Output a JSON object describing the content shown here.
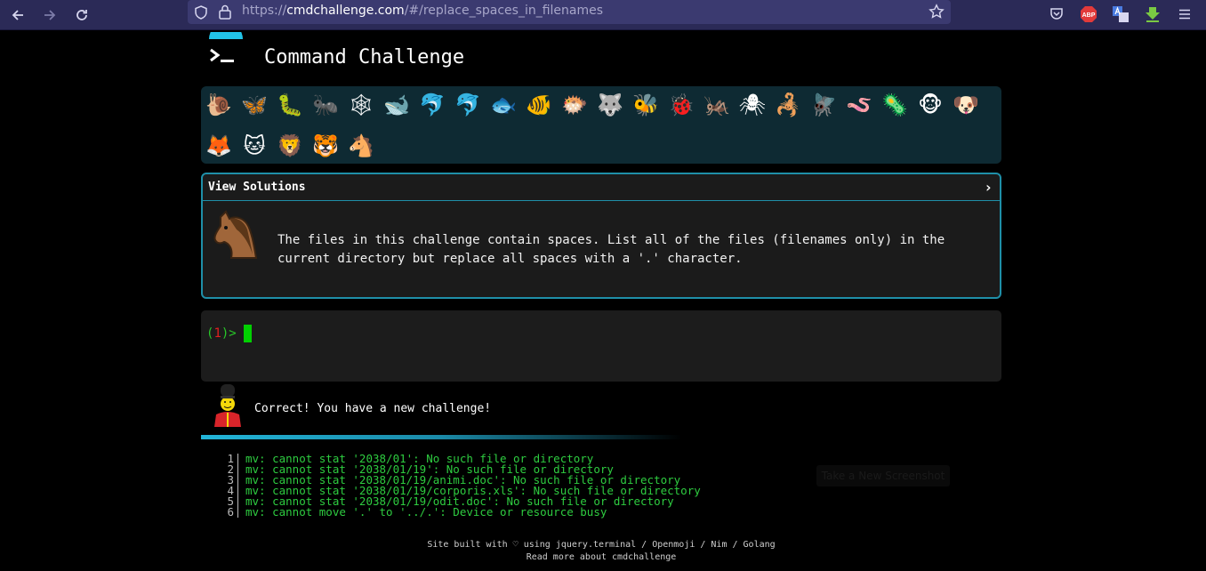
{
  "browser": {
    "url_prefix": "https://",
    "url_domain": "cmdchallenge.com",
    "url_path": "/#/replace_spaces_in_filenames",
    "ext_abp": "ABP"
  },
  "header": {
    "title": "Command Challenge"
  },
  "animals": [
    {
      "name": "snail",
      "glyph": "🐌"
    },
    {
      "name": "butterfly",
      "glyph": "🦋"
    },
    {
      "name": "caterpillar",
      "glyph": "🐛"
    },
    {
      "name": "ant",
      "glyph": "🐜"
    },
    {
      "name": "web",
      "glyph": "🕸"
    },
    {
      "name": "whale",
      "glyph": "🐋"
    },
    {
      "name": "dolphin",
      "glyph": "🐬"
    },
    {
      "name": "dolphin-grey",
      "glyph": "🐬"
    },
    {
      "name": "fish",
      "glyph": "🐟"
    },
    {
      "name": "tropical-fish",
      "glyph": "🐠"
    },
    {
      "name": "pufferfish",
      "glyph": "🐡"
    },
    {
      "name": "wolf",
      "glyph": "🐺"
    },
    {
      "name": "bee",
      "glyph": "🐝"
    },
    {
      "name": "ladybug",
      "glyph": "🐞"
    },
    {
      "name": "cricket",
      "glyph": "🦗"
    },
    {
      "name": "spider",
      "glyph": "🕷"
    },
    {
      "name": "scorpion",
      "glyph": "🦂"
    },
    {
      "name": "fly",
      "glyph": "🪰"
    },
    {
      "name": "worm",
      "glyph": "🪱"
    },
    {
      "name": "microbe",
      "glyph": "🦠"
    },
    {
      "name": "monkey",
      "glyph": "🐵"
    },
    {
      "name": "dog",
      "glyph": "🐶"
    },
    {
      "name": "fox",
      "glyph": "🦊"
    },
    {
      "name": "cat",
      "glyph": "🐱"
    },
    {
      "name": "lion",
      "glyph": "🦁"
    },
    {
      "name": "tiger",
      "glyph": "🐯"
    },
    {
      "name": "horse",
      "glyph": "🐴"
    }
  ],
  "challenge": {
    "view_solutions": "View Solutions",
    "chevron": "›",
    "description": "The files in this challenge contain spaces. List all of the files (filenames only) in the current directory but replace all spaces with a '.' character."
  },
  "terminal": {
    "prompt_open": "(",
    "prompt_num": "1",
    "prompt_close": ")>"
  },
  "status": {
    "message": "Correct! You have a new challenge!"
  },
  "output": [
    {
      "n": "1",
      "text": "mv: cannot stat '2038/01': No such file or directory"
    },
    {
      "n": "2",
      "text": "mv: cannot stat '2038/01/19': No such file or directory"
    },
    {
      "n": "3",
      "text": "mv: cannot stat '2038/01/19/animi.doc': No such file or directory"
    },
    {
      "n": "4",
      "text": "mv: cannot stat '2038/01/19/corporis.xls': No such file or directory"
    },
    {
      "n": "5",
      "text": "mv: cannot stat '2038/01/19/odit.doc': No such file or directory"
    },
    {
      "n": "6",
      "text": "mv: cannot move '.' to '../.': Device or resource busy"
    }
  ],
  "screenshot_button": "Take a New Screenshot",
  "footer": {
    "line1": "Site built with ♡ using jquery.terminal / Openmoji / Nim / Golang",
    "line2": "Read more about cmdchallenge"
  }
}
